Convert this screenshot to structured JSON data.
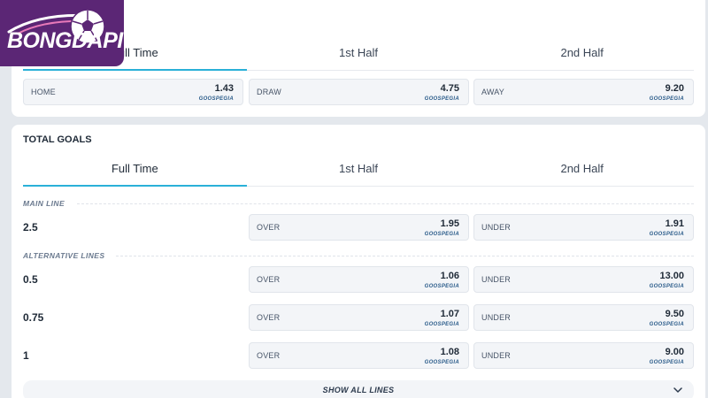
{
  "logo": {
    "text": "BONGDAPI"
  },
  "match_result": {
    "tabs": [
      {
        "label": "Full Time",
        "active": true
      },
      {
        "label": "1st Half",
        "active": false
      },
      {
        "label": "2nd Half",
        "active": false
      }
    ],
    "tab_partial_first": "ll Time",
    "odds": [
      {
        "label": "HOME",
        "value": "1.43",
        "brand": "GOOSPEGIA"
      },
      {
        "label": "DRAW",
        "value": "4.75",
        "brand": "GOOSPEGIA"
      },
      {
        "label": "AWAY",
        "value": "9.20",
        "brand": "GOOSPEGIA"
      }
    ]
  },
  "total_goals": {
    "title": "TOTAL GOALS",
    "tabs": [
      {
        "label": "Full Time",
        "active": true
      },
      {
        "label": "1st Half",
        "active": false
      },
      {
        "label": "2nd Half",
        "active": false
      }
    ],
    "main_line_heading": "MAIN LINE",
    "alternative_heading": "ALTERNATIVE LINES",
    "main_line": {
      "line": "2.5",
      "over": {
        "label": "OVER",
        "value": "1.95",
        "brand": "GOOSPEGIA"
      },
      "under": {
        "label": "UNDER",
        "value": "1.91",
        "brand": "GOOSPEGIA"
      }
    },
    "alternative_lines": [
      {
        "line": "0.5",
        "over": {
          "label": "OVER",
          "value": "1.06",
          "brand": "GOOSPEGIA"
        },
        "under": {
          "label": "UNDER",
          "value": "13.00",
          "brand": "GOOSPEGIA"
        }
      },
      {
        "line": "0.75",
        "over": {
          "label": "OVER",
          "value": "1.07",
          "brand": "GOOSPEGIA"
        },
        "under": {
          "label": "UNDER",
          "value": "9.50",
          "brand": "GOOSPEGIA"
        }
      },
      {
        "line": "1",
        "over": {
          "label": "OVER",
          "value": "1.08",
          "brand": "GOOSPEGIA"
        },
        "under": {
          "label": "UNDER",
          "value": "9.00",
          "brand": "GOOSPEGIA"
        }
      }
    ],
    "show_all_label": "SHOW ALL LINES",
    "show_all_icon": "chevron-down-icon"
  },
  "colors": {
    "accent": "#2ab0d8",
    "logo_bg": "#5b2675",
    "page_bg": "#e4e8ed"
  }
}
